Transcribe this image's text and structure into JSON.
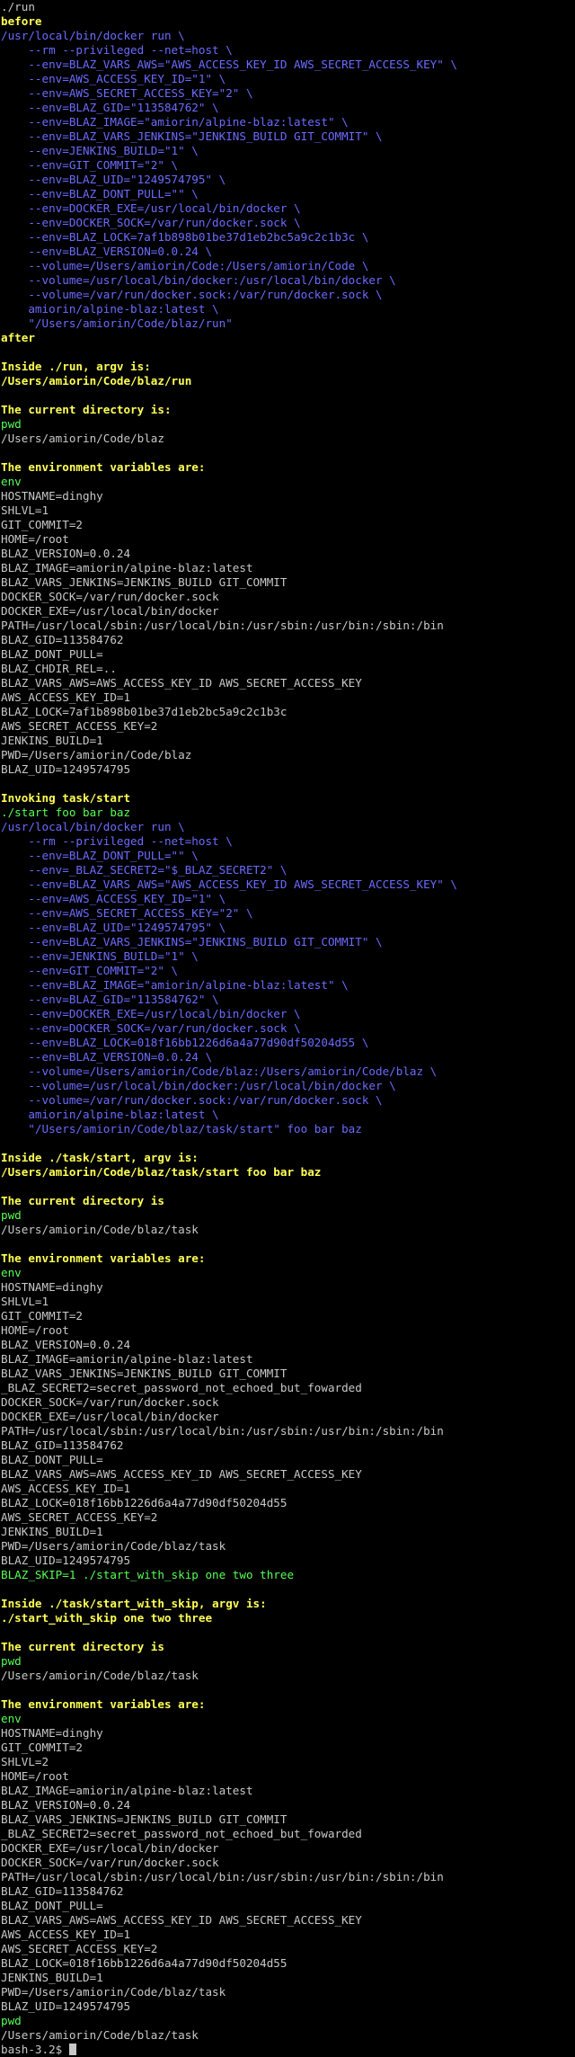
{
  "terminal": {
    "colors": {
      "background": "#000000",
      "output": "#c8c8c8",
      "command": "#6b6bff",
      "heading": "#ffff55",
      "shell_command": "#55ff55"
    },
    "prompt": "bash-3.2$ ",
    "lines": [
      {
        "t": "./run",
        "c": "out"
      },
      {
        "t": "before",
        "c": "yellow",
        "b": true
      },
      {
        "t": "/usr/local/bin/docker run \\",
        "c": "blue"
      },
      {
        "t": "    --rm --privileged --net=host \\",
        "c": "blue"
      },
      {
        "t": "    --env=BLAZ_VARS_AWS=\"AWS_ACCESS_KEY_ID AWS_SECRET_ACCESS_KEY\" \\",
        "c": "blue"
      },
      {
        "t": "    --env=AWS_ACCESS_KEY_ID=\"1\" \\",
        "c": "blue"
      },
      {
        "t": "    --env=AWS_SECRET_ACCESS_KEY=\"2\" \\",
        "c": "blue"
      },
      {
        "t": "    --env=BLAZ_GID=\"113584762\" \\",
        "c": "blue"
      },
      {
        "t": "    --env=BLAZ_IMAGE=\"amiorin/alpine-blaz:latest\" \\",
        "c": "blue"
      },
      {
        "t": "    --env=BLAZ_VARS_JENKINS=\"JENKINS_BUILD GIT_COMMIT\" \\",
        "c": "blue"
      },
      {
        "t": "    --env=JENKINS_BUILD=\"1\" \\",
        "c": "blue"
      },
      {
        "t": "    --env=GIT_COMMIT=\"2\" \\",
        "c": "blue"
      },
      {
        "t": "    --env=BLAZ_UID=\"1249574795\" \\",
        "c": "blue"
      },
      {
        "t": "    --env=BLAZ_DONT_PULL=\"\" \\",
        "c": "blue"
      },
      {
        "t": "    --env=DOCKER_EXE=/usr/local/bin/docker \\",
        "c": "blue"
      },
      {
        "t": "    --env=DOCKER_SOCK=/var/run/docker.sock \\",
        "c": "blue"
      },
      {
        "t": "    --env=BLAZ_LOCK=7af1b898b01be37d1eb2bc5a9c2c1b3c \\",
        "c": "blue"
      },
      {
        "t": "    --env=BLAZ_VERSION=0.0.24 \\",
        "c": "blue"
      },
      {
        "t": "    --volume=/Users/amiorin/Code:/Users/amiorin/Code \\",
        "c": "blue"
      },
      {
        "t": "    --volume=/usr/local/bin/docker:/usr/local/bin/docker \\",
        "c": "blue"
      },
      {
        "t": "    --volume=/var/run/docker.sock:/var/run/docker.sock \\",
        "c": "blue"
      },
      {
        "t": "    amiorin/alpine-blaz:latest \\",
        "c": "blue"
      },
      {
        "t": "    \"/Users/amiorin/Code/blaz/run\"",
        "c": "blue"
      },
      {
        "t": "after",
        "c": "yellow",
        "b": true
      },
      {
        "t": "",
        "c": "out"
      },
      {
        "t": "Inside ./run, argv is:",
        "c": "yellow",
        "b": true
      },
      {
        "t": "/Users/amiorin/Code/blaz/run",
        "c": "yellow",
        "b": true
      },
      {
        "t": "",
        "c": "out"
      },
      {
        "t": "The current directory is:",
        "c": "yellow",
        "b": true
      },
      {
        "t": "pwd",
        "c": "green"
      },
      {
        "t": "/Users/amiorin/Code/blaz",
        "c": "out"
      },
      {
        "t": "",
        "c": "out"
      },
      {
        "t": "The environment variables are:",
        "c": "yellow",
        "b": true
      },
      {
        "t": "env",
        "c": "green"
      },
      {
        "t": "HOSTNAME=dinghy",
        "c": "out"
      },
      {
        "t": "SHLVL=1",
        "c": "out"
      },
      {
        "t": "GIT_COMMIT=2",
        "c": "out"
      },
      {
        "t": "HOME=/root",
        "c": "out"
      },
      {
        "t": "BLAZ_VERSION=0.0.24",
        "c": "out"
      },
      {
        "t": "BLAZ_IMAGE=amiorin/alpine-blaz:latest",
        "c": "out"
      },
      {
        "t": "BLAZ_VARS_JENKINS=JENKINS_BUILD GIT_COMMIT",
        "c": "out"
      },
      {
        "t": "DOCKER_SOCK=/var/run/docker.sock",
        "c": "out"
      },
      {
        "t": "DOCKER_EXE=/usr/local/bin/docker",
        "c": "out"
      },
      {
        "t": "PATH=/usr/local/sbin:/usr/local/bin:/usr/sbin:/usr/bin:/sbin:/bin",
        "c": "out"
      },
      {
        "t": "BLAZ_GID=113584762",
        "c": "out"
      },
      {
        "t": "BLAZ_DONT_PULL=",
        "c": "out"
      },
      {
        "t": "BLAZ_CHDIR_REL=..",
        "c": "out"
      },
      {
        "t": "BLAZ_VARS_AWS=AWS_ACCESS_KEY_ID AWS_SECRET_ACCESS_KEY",
        "c": "out"
      },
      {
        "t": "AWS_ACCESS_KEY_ID=1",
        "c": "out"
      },
      {
        "t": "BLAZ_LOCK=7af1b898b01be37d1eb2bc5a9c2c1b3c",
        "c": "out"
      },
      {
        "t": "AWS_SECRET_ACCESS_KEY=2",
        "c": "out"
      },
      {
        "t": "JENKINS_BUILD=1",
        "c": "out"
      },
      {
        "t": "PWD=/Users/amiorin/Code/blaz",
        "c": "out"
      },
      {
        "t": "BLAZ_UID=1249574795",
        "c": "out"
      },
      {
        "t": "",
        "c": "out"
      },
      {
        "t": "Invoking task/start",
        "c": "yellow",
        "b": true
      },
      {
        "t": "./start foo bar baz",
        "c": "green"
      },
      {
        "t": "/usr/local/bin/docker run \\",
        "c": "blue"
      },
      {
        "t": "    --rm --privileged --net=host \\",
        "c": "blue"
      },
      {
        "t": "    --env=BLAZ_DONT_PULL=\"\" \\",
        "c": "blue"
      },
      {
        "t": "    --env=_BLAZ_SECRET2=\"$_BLAZ_SECRET2\" \\",
        "c": "blue"
      },
      {
        "t": "    --env=BLAZ_VARS_AWS=\"AWS_ACCESS_KEY_ID AWS_SECRET_ACCESS_KEY\" \\",
        "c": "blue"
      },
      {
        "t": "    --env=AWS_ACCESS_KEY_ID=\"1\" \\",
        "c": "blue"
      },
      {
        "t": "    --env=AWS_SECRET_ACCESS_KEY=\"2\" \\",
        "c": "blue"
      },
      {
        "t": "    --env=BLAZ_UID=\"1249574795\" \\",
        "c": "blue"
      },
      {
        "t": "    --env=BLAZ_VARS_JENKINS=\"JENKINS_BUILD GIT_COMMIT\" \\",
        "c": "blue"
      },
      {
        "t": "    --env=JENKINS_BUILD=\"1\" \\",
        "c": "blue"
      },
      {
        "t": "    --env=GIT_COMMIT=\"2\" \\",
        "c": "blue"
      },
      {
        "t": "    --env=BLAZ_IMAGE=\"amiorin/alpine-blaz:latest\" \\",
        "c": "blue"
      },
      {
        "t": "    --env=BLAZ_GID=\"113584762\" \\",
        "c": "blue"
      },
      {
        "t": "    --env=DOCKER_EXE=/usr/local/bin/docker \\",
        "c": "blue"
      },
      {
        "t": "    --env=DOCKER_SOCK=/var/run/docker.sock \\",
        "c": "blue"
      },
      {
        "t": "    --env=BLAZ_LOCK=018f16bb1226d6a4a77d90df50204d55 \\",
        "c": "blue"
      },
      {
        "t": "    --env=BLAZ_VERSION=0.0.24 \\",
        "c": "blue"
      },
      {
        "t": "    --volume=/Users/amiorin/Code/blaz:/Users/amiorin/Code/blaz \\",
        "c": "blue"
      },
      {
        "t": "    --volume=/usr/local/bin/docker:/usr/local/bin/docker \\",
        "c": "blue"
      },
      {
        "t": "    --volume=/var/run/docker.sock:/var/run/docker.sock \\",
        "c": "blue"
      },
      {
        "t": "    amiorin/alpine-blaz:latest \\",
        "c": "blue"
      },
      {
        "t": "    \"/Users/amiorin/Code/blaz/task/start\" foo bar baz",
        "c": "blue"
      },
      {
        "t": "",
        "c": "out"
      },
      {
        "t": "Inside ./task/start, argv is:",
        "c": "yellow",
        "b": true
      },
      {
        "t": "/Users/amiorin/Code/blaz/task/start foo bar baz",
        "c": "yellow",
        "b": true
      },
      {
        "t": "",
        "c": "out"
      },
      {
        "t": "The current directory is",
        "c": "yellow",
        "b": true
      },
      {
        "t": "pwd",
        "c": "green"
      },
      {
        "t": "/Users/amiorin/Code/blaz/task",
        "c": "out"
      },
      {
        "t": "",
        "c": "out"
      },
      {
        "t": "The environment variables are:",
        "c": "yellow",
        "b": true
      },
      {
        "t": "env",
        "c": "green"
      },
      {
        "t": "HOSTNAME=dinghy",
        "c": "out"
      },
      {
        "t": "SHLVL=1",
        "c": "out"
      },
      {
        "t": "GIT_COMMIT=2",
        "c": "out"
      },
      {
        "t": "HOME=/root",
        "c": "out"
      },
      {
        "t": "BLAZ_VERSION=0.0.24",
        "c": "out"
      },
      {
        "t": "BLAZ_IMAGE=amiorin/alpine-blaz:latest",
        "c": "out"
      },
      {
        "t": "BLAZ_VARS_JENKINS=JENKINS_BUILD GIT_COMMIT",
        "c": "out"
      },
      {
        "t": "_BLAZ_SECRET2=secret_password_not_echoed_but_fowarded",
        "c": "out"
      },
      {
        "t": "DOCKER_SOCK=/var/run/docker.sock",
        "c": "out"
      },
      {
        "t": "DOCKER_EXE=/usr/local/bin/docker",
        "c": "out"
      },
      {
        "t": "PATH=/usr/local/sbin:/usr/local/bin:/usr/sbin:/usr/bin:/sbin:/bin",
        "c": "out"
      },
      {
        "t": "BLAZ_GID=113584762",
        "c": "out"
      },
      {
        "t": "BLAZ_DONT_PULL=",
        "c": "out"
      },
      {
        "t": "BLAZ_VARS_AWS=AWS_ACCESS_KEY_ID AWS_SECRET_ACCESS_KEY",
        "c": "out"
      },
      {
        "t": "AWS_ACCESS_KEY_ID=1",
        "c": "out"
      },
      {
        "t": "BLAZ_LOCK=018f16bb1226d6a4a77d90df50204d55",
        "c": "out"
      },
      {
        "t": "AWS_SECRET_ACCESS_KEY=2",
        "c": "out"
      },
      {
        "t": "JENKINS_BUILD=1",
        "c": "out"
      },
      {
        "t": "PWD=/Users/amiorin/Code/blaz/task",
        "c": "out"
      },
      {
        "t": "BLAZ_UID=1249574795",
        "c": "out"
      },
      {
        "t": "BLAZ_SKIP=1 ./start_with_skip one two three",
        "c": "green"
      },
      {
        "t": "",
        "c": "out"
      },
      {
        "t": "Inside ./task/start_with_skip, argv is:",
        "c": "yellow",
        "b": true
      },
      {
        "t": "./start_with_skip one two three",
        "c": "yellow",
        "b": true
      },
      {
        "t": "",
        "c": "out"
      },
      {
        "t": "The current directory is",
        "c": "yellow",
        "b": true
      },
      {
        "t": "pwd",
        "c": "green"
      },
      {
        "t": "/Users/amiorin/Code/blaz/task",
        "c": "out"
      },
      {
        "t": "",
        "c": "out"
      },
      {
        "t": "The environment variables are:",
        "c": "yellow",
        "b": true
      },
      {
        "t": "env",
        "c": "green"
      },
      {
        "t": "HOSTNAME=dinghy",
        "c": "out"
      },
      {
        "t": "GIT_COMMIT=2",
        "c": "out"
      },
      {
        "t": "SHLVL=2",
        "c": "out"
      },
      {
        "t": "HOME=/root",
        "c": "out"
      },
      {
        "t": "BLAZ_IMAGE=amiorin/alpine-blaz:latest",
        "c": "out"
      },
      {
        "t": "BLAZ_VERSION=0.0.24",
        "c": "out"
      },
      {
        "t": "BLAZ_VARS_JENKINS=JENKINS_BUILD GIT_COMMIT",
        "c": "out"
      },
      {
        "t": "_BLAZ_SECRET2=secret_password_not_echoed_but_fowarded",
        "c": "out"
      },
      {
        "t": "DOCKER_EXE=/usr/local/bin/docker",
        "c": "out"
      },
      {
        "t": "DOCKER_SOCK=/var/run/docker.sock",
        "c": "out"
      },
      {
        "t": "PATH=/usr/local/sbin:/usr/local/bin:/usr/sbin:/usr/bin:/sbin:/bin",
        "c": "out"
      },
      {
        "t": "BLAZ_GID=113584762",
        "c": "out"
      },
      {
        "t": "BLAZ_DONT_PULL=",
        "c": "out"
      },
      {
        "t": "BLAZ_VARS_AWS=AWS_ACCESS_KEY_ID AWS_SECRET_ACCESS_KEY",
        "c": "out"
      },
      {
        "t": "AWS_ACCESS_KEY_ID=1",
        "c": "out"
      },
      {
        "t": "AWS_SECRET_ACCESS_KEY=2",
        "c": "out"
      },
      {
        "t": "BLAZ_LOCK=018f16bb1226d6a4a77d90df50204d55",
        "c": "out"
      },
      {
        "t": "JENKINS_BUILD=1",
        "c": "out"
      },
      {
        "t": "PWD=/Users/amiorin/Code/blaz/task",
        "c": "out"
      },
      {
        "t": "BLAZ_UID=1249574795",
        "c": "out"
      },
      {
        "t": "pwd",
        "c": "green"
      },
      {
        "t": "/Users/amiorin/Code/blaz/task",
        "c": "out"
      }
    ]
  }
}
